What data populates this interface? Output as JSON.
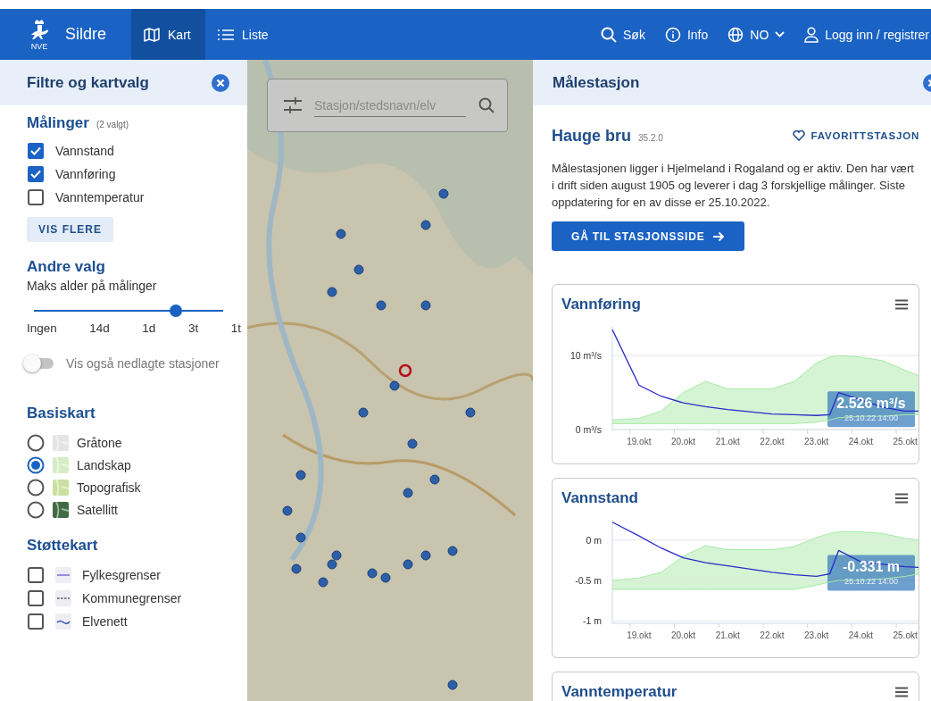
{
  "header": {
    "logo_text": "NVE",
    "app_name": "Sildre",
    "tabs": [
      {
        "label": "Kart",
        "kind": "map",
        "selected": true
      },
      {
        "label": "Liste",
        "kind": "list",
        "selected": false
      }
    ],
    "actions": [
      {
        "label": "Søk",
        "kind": "search"
      },
      {
        "label": "Info",
        "kind": "info"
      },
      {
        "label": "NO",
        "kind": "language"
      },
      {
        "label": "Logg inn / registrer",
        "kind": "user"
      }
    ]
  },
  "filter_panel": {
    "title": "Filtre og kartvalg",
    "measurements": {
      "heading": "Målinger",
      "count": "(2 valgt)",
      "items": [
        {
          "label": "Vannstand",
          "checked": true
        },
        {
          "label": "Vannføring",
          "checked": true
        },
        {
          "label": "Vanntemperatur",
          "checked": false
        }
      ]
    },
    "more_button": "VIS FLERE",
    "other": {
      "heading": "Andre valg",
      "slider_label": "Maks alder på målinger",
      "slider": {
        "level": 0.75,
        "stops": [
          "Ingen",
          "14d",
          "1d",
          "3t",
          "1t"
        ]
      },
      "toggle": {
        "label": "Vis også nedlagte stasjoner",
        "on": false
      }
    },
    "base_maps": {
      "heading": "Basiskart",
      "items": [
        {
          "label": "Gråtone",
          "selected": false,
          "color": "#e4e4e4"
        },
        {
          "label": "Landskap",
          "selected": true,
          "color": "#d6ecc4"
        },
        {
          "label": "Topografisk",
          "selected": false,
          "color": "#c9e0a0"
        },
        {
          "label": "Satellitt",
          "selected": false,
          "color": "#3f6a43"
        }
      ]
    },
    "overlay_maps": {
      "heading": "Støttekart",
      "items": [
        {
          "label": "Fylkesgrenser",
          "checked": false,
          "kind": "solid"
        },
        {
          "label": "Kommunegrenser",
          "checked": false,
          "kind": "dashed"
        },
        {
          "label": "Elvenett",
          "checked": false,
          "kind": "wavy"
        }
      ]
    }
  },
  "map": {
    "search": {
      "placeholder": "Stasjon/stedsnavn/elv"
    }
  },
  "station_panel": {
    "title": "Målestasjon",
    "station": {
      "name": "Hauge bru",
      "number": "35.2.0"
    },
    "favorite_button": "FAVORITTSTASJON",
    "description": "Målestasjonen ligger i Hjelmeland i Rogaland og er aktiv. Den har vært i drift siden august 1905 og leverer i dag 3 forskjellige målinger. Siste oppdatering for en av disse er 25.10.2022.",
    "station_button": "GÅ TIL STASJONSSIDE",
    "charts": [
      {
        "title": "Vannføring",
        "tooltip": {
          "value": "2.526 m³/s",
          "time": "25.10.22 14:00"
        },
        "chart_data": {
          "type": "line",
          "x": [
            18.4,
            19,
            19.5,
            20,
            20.5,
            21,
            22,
            22.5,
            23,
            23.3,
            23.5,
            24,
            24.5,
            25,
            25.3
          ],
          "series": [
            {
              "color": "#2b2bc8",
              "values": [
                13.5,
                6,
                4.5,
                3.6,
                3.1,
                2.7,
                2.1,
                2.0,
                1.9,
                2.0,
                5,
                4,
                3,
                2.5,
                2.5
              ]
            },
            {
              "color": "#a6eaa6",
              "values": [
                1.3,
                1.5,
                2.5,
                5,
                6.5,
                5.5,
                5.5,
                6.5,
                9,
                9.8,
                10,
                9.8,
                9.3,
                8,
                7.3
              ]
            },
            {
              "color": "#a6eaa6",
              "values": [
                0.8,
                0.8,
                0.8,
                0.8,
                0.8,
                0.8,
                0.8,
                0.8,
                1.0,
                1.3,
                1.6,
                1.8,
                1.8,
                2.0,
                2.0
              ]
            }
          ],
          "grid": true,
          "xlim": [
            18.4,
            25.4
          ],
          "ylim": [
            0,
            14
          ],
          "xticks": [
            {
              "value": 19,
              "label": "19.okt"
            },
            {
              "value": 20,
              "label": "20.okt"
            },
            {
              "value": 21,
              "label": "21.okt"
            },
            {
              "value": 22,
              "label": "22.okt"
            },
            {
              "value": 23,
              "label": "23.okt"
            },
            {
              "value": 24,
              "label": "24.okt"
            },
            {
              "value": 25,
              "label": "25.okt"
            }
          ],
          "yticks": [
            {
              "value": 0,
              "label": "0 m³/s"
            },
            {
              "value": 10,
              "label": "10 m³/s"
            }
          ]
        }
      },
      {
        "title": "Vannstand",
        "tooltip": {
          "value": "-0.331 m",
          "time": "25.10.22 14:00"
        },
        "chart_data": {
          "type": "line",
          "x": [
            18.4,
            19,
            19.5,
            20,
            20.5,
            21,
            22,
            22.5,
            23,
            23.3,
            23.5,
            24,
            24.5,
            25,
            25.3
          ],
          "series": [
            {
              "color": "#2b2bc8",
              "values": [
                0.22,
                0.05,
                -0.1,
                -0.22,
                -0.28,
                -0.32,
                -0.4,
                -0.43,
                -0.45,
                -0.42,
                -0.13,
                -0.27,
                -0.3,
                -0.33,
                -0.34
              ]
            },
            {
              "color": "#a6eaa6",
              "values": [
                -0.5,
                -0.47,
                -0.4,
                -0.2,
                -0.07,
                -0.12,
                -0.12,
                -0.08,
                0.03,
                0.08,
                0.1,
                0.1,
                0.08,
                0.02,
                0
              ]
            },
            {
              "color": "#a6eaa6",
              "values": [
                -0.61,
                -0.61,
                -0.61,
                -0.61,
                -0.61,
                -0.61,
                -0.61,
                -0.61,
                -0.56,
                -0.52,
                -0.5,
                -0.5,
                -0.48,
                -0.45,
                -0.42
              ]
            }
          ],
          "grid": true,
          "xlim": [
            18.4,
            25.4
          ],
          "ylim": [
            -1.03,
            0.25
          ],
          "xticks": [
            {
              "value": 19,
              "label": "19.okt"
            },
            {
              "value": 20,
              "label": "20.okt"
            },
            {
              "value": 21,
              "label": "21.okt"
            },
            {
              "value": 22,
              "label": "22.okt"
            },
            {
              "value": 23,
              "label": "23.okt"
            },
            {
              "value": 24,
              "label": "24.okt"
            },
            {
              "value": 25,
              "label": "25.okt"
            }
          ],
          "yticks": [
            {
              "value": 0,
              "label": "0 m"
            },
            {
              "value": -0.5,
              "label": "-0.5 m"
            },
            {
              "value": -1,
              "label": "-1 m"
            }
          ]
        }
      },
      {
        "title": "Vanntemperatur"
      }
    ]
  }
}
